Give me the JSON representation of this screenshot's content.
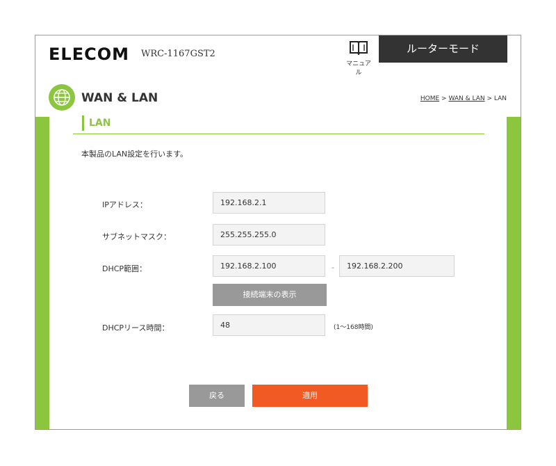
{
  "header": {
    "brand": "ELECOM",
    "model": "WRC-1167GST2",
    "manual_label": "マニュアル",
    "mode_label": "ルーターモード"
  },
  "page": {
    "title": "WAN & LAN",
    "breadcrumb": {
      "home": "HOME",
      "sep1": " > ",
      "section": "WAN & LAN",
      "sep2": " > ",
      "current": "LAN"
    },
    "section_title": "LAN",
    "description": "本製品のLAN設定を行います。"
  },
  "form": {
    "ip_label": "IPアドレス：",
    "ip_value": "192.168.2.1",
    "subnet_label": "サブネットマスク：",
    "subnet_value": "255.255.255.0",
    "dhcp_range_label": "DHCP範囲：",
    "dhcp_start": "192.168.2.100",
    "dhcp_separator": "-",
    "dhcp_end": "192.168.2.200",
    "show_clients_label": "接続端末の表示",
    "lease_label": "DHCPリース時間：",
    "lease_value": "48",
    "lease_hint": "(1～168時間)"
  },
  "actions": {
    "back_label": "戻る",
    "apply_label": "適用"
  },
  "colors": {
    "accent_green": "#8cc63f",
    "apply_orange": "#f15a22",
    "dark_button": "#333333",
    "gray_button": "#999999"
  },
  "icons": {
    "manual": "book-icon",
    "section": "globe-icon"
  }
}
